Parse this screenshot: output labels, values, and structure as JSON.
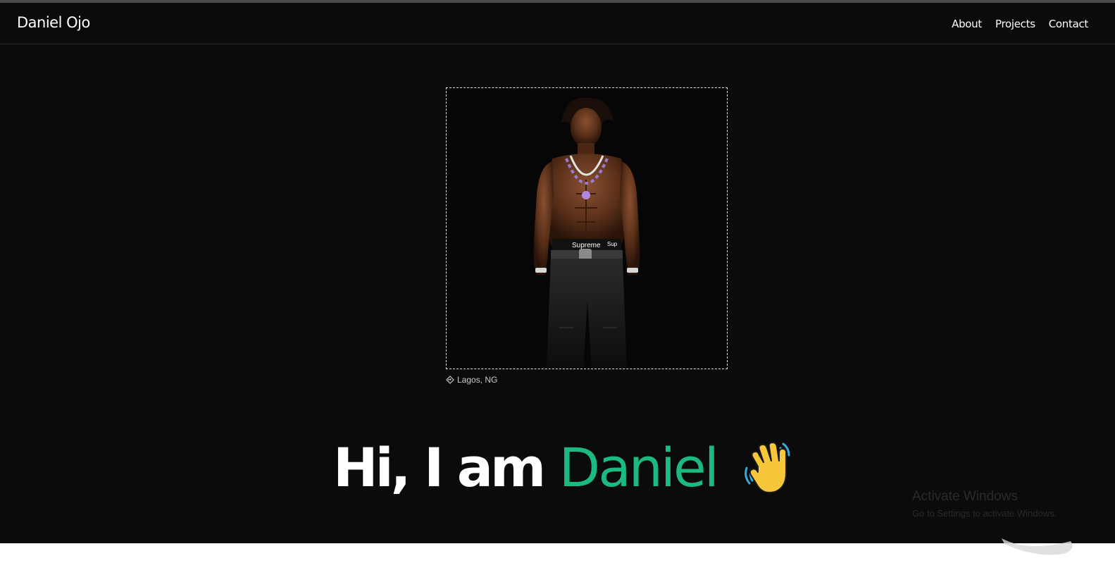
{
  "brand": {
    "name": "Daniel Ojo"
  },
  "nav": {
    "items": [
      "About",
      "Projects",
      "Contact"
    ]
  },
  "profile": {
    "location": "Lagos, NG",
    "location_icon": "location-diamond-icon",
    "photo_brand_text": "Supreme",
    "photo_brand_text_short": "Sup"
  },
  "hero": {
    "greeting": "Hi, I am ",
    "name": "Daniel",
    "wave_icon": "waving-hand-icon",
    "accent_color": "#1cb980"
  },
  "watermark": {
    "title": "Activate Windows",
    "subtitle": "Go to Settings to activate Windows."
  }
}
